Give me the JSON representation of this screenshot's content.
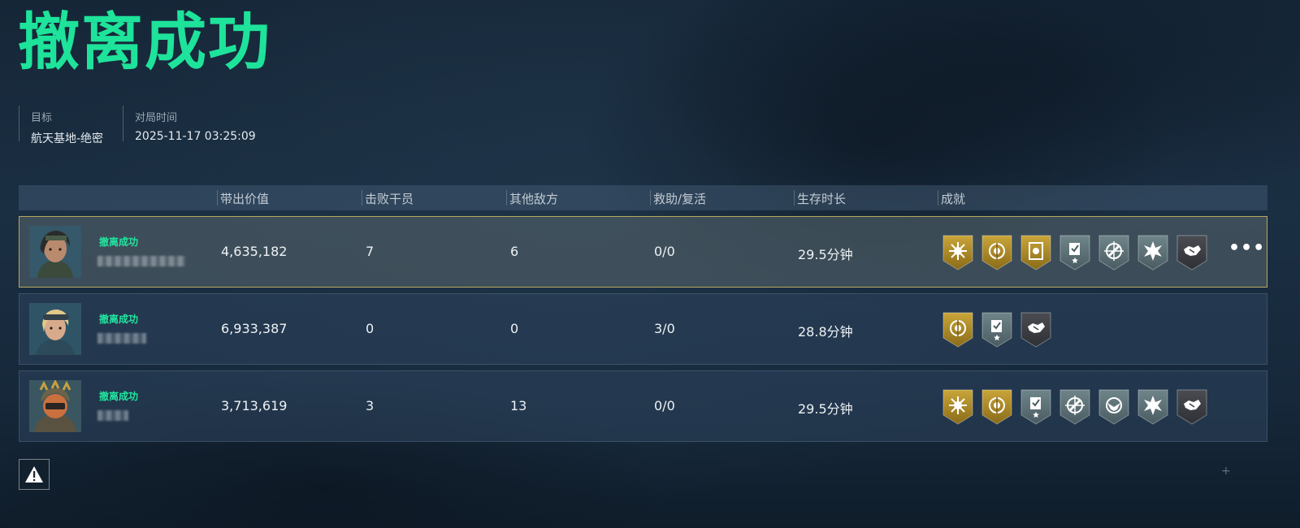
{
  "title": "撤离成功",
  "info": {
    "target_label": "目标",
    "target_value": "航天基地-绝密",
    "time_label": "对局时间",
    "time_value": "2025-11-17 03:25:09"
  },
  "table": {
    "headers": [
      "带出价值",
      "击败干员",
      "其他敌方",
      "救助/复活",
      "生存时长",
      "成就"
    ],
    "rows": [
      {
        "status": "撤离成功",
        "value": "4,635,182",
        "kills": "7",
        "other": "6",
        "assist": "0/0",
        "time": "29.5分钟",
        "highlight": true,
        "badges": [
          {
            "icon": "sun-burst-icon",
            "tier": "gold"
          },
          {
            "icon": "emblem-circle-icon",
            "tier": "gold"
          },
          {
            "icon": "card-icon",
            "tier": "gold"
          },
          {
            "icon": "clipboard-check-icon",
            "tier": "silver"
          },
          {
            "icon": "crosshair-icon",
            "tier": "silver"
          },
          {
            "icon": "star-burst-icon",
            "tier": "silver"
          },
          {
            "icon": "handshake-icon",
            "tier": "dark"
          }
        ],
        "more": "•••"
      },
      {
        "status": "撤离成功",
        "value": "6,933,387",
        "kills": "0",
        "other": "0",
        "assist": "3/0",
        "time": "28.8分钟",
        "highlight": false,
        "badges": [
          {
            "icon": "emblem-circle-icon",
            "tier": "gold"
          },
          {
            "icon": "clipboard-check-icon",
            "tier": "silver"
          },
          {
            "icon": "handshake-icon",
            "tier": "dark"
          }
        ]
      },
      {
        "status": "撤离成功",
        "value": "3,713,619",
        "kills": "3",
        "other": "13",
        "assist": "0/0",
        "time": "29.5分钟",
        "highlight": false,
        "badges": [
          {
            "icon": "sun-burst-icon",
            "tier": "gold"
          },
          {
            "icon": "emblem-circle-icon",
            "tier": "gold"
          },
          {
            "icon": "clipboard-check-icon",
            "tier": "silver"
          },
          {
            "icon": "crosshair-icon",
            "tier": "silver"
          },
          {
            "icon": "eagle-emblem-icon",
            "tier": "silver"
          },
          {
            "icon": "star-burst-icon",
            "tier": "silver"
          },
          {
            "icon": "handshake-icon",
            "tier": "dark"
          }
        ]
      }
    ]
  },
  "colors": {
    "accent": "#1ee39a",
    "highlight_border": "#b8a75e",
    "badge_gold": "#b3922f",
    "badge_silver": "#5f7479",
    "badge_dark": "#3d3f44"
  },
  "warning_icon": "warning-triangle-icon"
}
